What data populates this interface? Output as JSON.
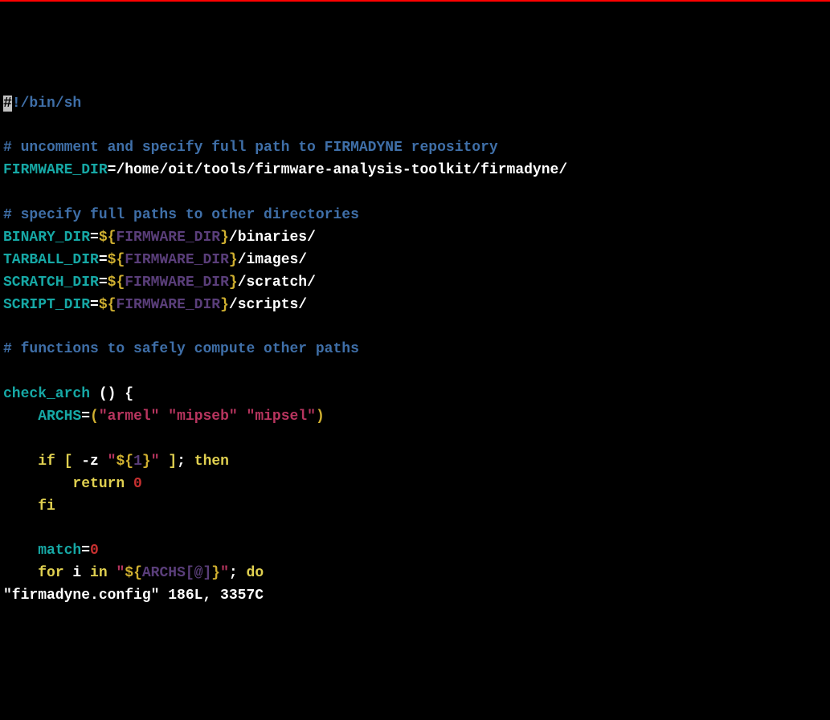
{
  "lines": [
    {
      "tokens": [
        {
          "t": "#",
          "cls": "cursor"
        },
        {
          "t": "!/bin/sh",
          "cls": "comment"
        }
      ]
    },
    {
      "tokens": [
        {
          "t": "",
          "cls": "white"
        }
      ]
    },
    {
      "tokens": [
        {
          "t": "# uncomment and specify full path to FIRMADYNE repository",
          "cls": "comment"
        }
      ]
    },
    {
      "tokens": [
        {
          "t": "FIRMWARE_DIR",
          "cls": "identifier"
        },
        {
          "t": "=",
          "cls": "white"
        },
        {
          "t": "/home/oit/tools/firmware-analysis-toolkit/firmadyne/",
          "cls": "white"
        }
      ]
    },
    {
      "tokens": [
        {
          "t": "",
          "cls": "white"
        }
      ]
    },
    {
      "tokens": [
        {
          "t": "# specify full paths to other directories",
          "cls": "comment"
        }
      ]
    },
    {
      "tokens": [
        {
          "t": "BINARY_DIR",
          "cls": "identifier"
        },
        {
          "t": "=",
          "cls": "white"
        },
        {
          "t": "${",
          "cls": "yellow"
        },
        {
          "t": "FIRMWARE_DIR",
          "cls": "varname"
        },
        {
          "t": "}",
          "cls": "yellow"
        },
        {
          "t": "/binaries/",
          "cls": "white"
        }
      ]
    },
    {
      "tokens": [
        {
          "t": "TARBALL_DIR",
          "cls": "identifier"
        },
        {
          "t": "=",
          "cls": "white"
        },
        {
          "t": "${",
          "cls": "yellow"
        },
        {
          "t": "FIRMWARE_DIR",
          "cls": "varname"
        },
        {
          "t": "}",
          "cls": "yellow"
        },
        {
          "t": "/images/",
          "cls": "white"
        }
      ]
    },
    {
      "tokens": [
        {
          "t": "SCRATCH_DIR",
          "cls": "identifier"
        },
        {
          "t": "=",
          "cls": "white"
        },
        {
          "t": "${",
          "cls": "yellow"
        },
        {
          "t": "FIRMWARE_DIR",
          "cls": "varname"
        },
        {
          "t": "}",
          "cls": "yellow"
        },
        {
          "t": "/scratch/",
          "cls": "white"
        }
      ]
    },
    {
      "tokens": [
        {
          "t": "SCRIPT_DIR",
          "cls": "identifier"
        },
        {
          "t": "=",
          "cls": "white"
        },
        {
          "t": "${",
          "cls": "yellow"
        },
        {
          "t": "FIRMWARE_DIR",
          "cls": "varname"
        },
        {
          "t": "}",
          "cls": "yellow"
        },
        {
          "t": "/scripts/",
          "cls": "white"
        }
      ]
    },
    {
      "tokens": [
        {
          "t": "",
          "cls": "white"
        }
      ]
    },
    {
      "tokens": [
        {
          "t": "# functions to safely compute other paths",
          "cls": "comment"
        }
      ]
    },
    {
      "tokens": [
        {
          "t": "",
          "cls": "white"
        }
      ]
    },
    {
      "tokens": [
        {
          "t": "check_arch ",
          "cls": "identifier"
        },
        {
          "t": "()",
          "cls": "white"
        },
        {
          "t": " {",
          "cls": "white"
        }
      ]
    },
    {
      "tokens": [
        {
          "t": "    ",
          "cls": "white"
        },
        {
          "t": "ARCHS",
          "cls": "identifier"
        },
        {
          "t": "=",
          "cls": "white"
        },
        {
          "t": "(",
          "cls": "yellow"
        },
        {
          "t": "\"armel\"",
          "cls": "string"
        },
        {
          "t": " ",
          "cls": "white"
        },
        {
          "t": "\"mipseb\"",
          "cls": "string"
        },
        {
          "t": " ",
          "cls": "white"
        },
        {
          "t": "\"mipsel\"",
          "cls": "string"
        },
        {
          "t": ")",
          "cls": "yellow"
        }
      ]
    },
    {
      "tokens": [
        {
          "t": "",
          "cls": "white"
        }
      ]
    },
    {
      "tokens": [
        {
          "t": "    ",
          "cls": "white"
        },
        {
          "t": "if",
          "cls": "keyword"
        },
        {
          "t": " ",
          "cls": "white"
        },
        {
          "t": "[",
          "cls": "keyword"
        },
        {
          "t": " -z ",
          "cls": "white"
        },
        {
          "t": "\"",
          "cls": "string"
        },
        {
          "t": "${",
          "cls": "yellow"
        },
        {
          "t": "1",
          "cls": "varname"
        },
        {
          "t": "}",
          "cls": "yellow"
        },
        {
          "t": "\"",
          "cls": "string"
        },
        {
          "t": " ",
          "cls": "white"
        },
        {
          "t": "]",
          "cls": "keyword"
        },
        {
          "t": ";",
          "cls": "white"
        },
        {
          "t": " ",
          "cls": "white"
        },
        {
          "t": "then",
          "cls": "keyword"
        }
      ]
    },
    {
      "tokens": [
        {
          "t": "        ",
          "cls": "white"
        },
        {
          "t": "return",
          "cls": "keyword"
        },
        {
          "t": " ",
          "cls": "white"
        },
        {
          "t": "0",
          "cls": "number"
        }
      ]
    },
    {
      "tokens": [
        {
          "t": "    ",
          "cls": "white"
        },
        {
          "t": "fi",
          "cls": "keyword"
        }
      ]
    },
    {
      "tokens": [
        {
          "t": "",
          "cls": "white"
        }
      ]
    },
    {
      "tokens": [
        {
          "t": "    ",
          "cls": "white"
        },
        {
          "t": "match",
          "cls": "identifier"
        },
        {
          "t": "=",
          "cls": "white"
        },
        {
          "t": "0",
          "cls": "number"
        }
      ]
    },
    {
      "tokens": [
        {
          "t": "    ",
          "cls": "white"
        },
        {
          "t": "for",
          "cls": "keyword"
        },
        {
          "t": " i ",
          "cls": "white"
        },
        {
          "t": "in",
          "cls": "keyword"
        },
        {
          "t": " ",
          "cls": "white"
        },
        {
          "t": "\"",
          "cls": "string"
        },
        {
          "t": "${",
          "cls": "yellow"
        },
        {
          "t": "ARCHS[@]",
          "cls": "varname"
        },
        {
          "t": "}",
          "cls": "yellow"
        },
        {
          "t": "\"",
          "cls": "string"
        },
        {
          "t": ";",
          "cls": "white"
        },
        {
          "t": " ",
          "cls": "white"
        },
        {
          "t": "do",
          "cls": "keyword"
        }
      ]
    }
  ],
  "statusline": "\"firmadyne.config\" 186L, 3357C"
}
